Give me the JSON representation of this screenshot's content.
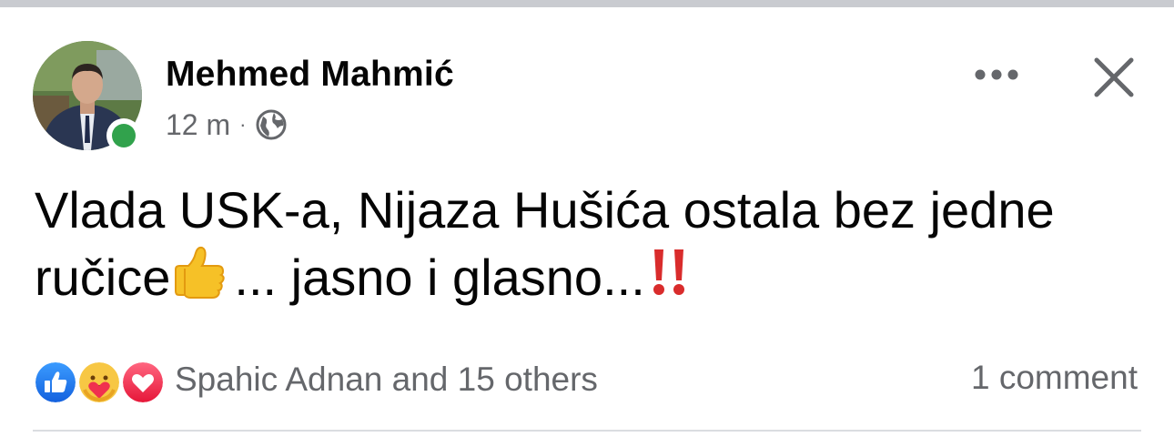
{
  "post": {
    "author": "Mehmed Mahmić",
    "time": "12 m",
    "separator": "·",
    "privacy_icon": "globe-icon",
    "online": true,
    "text_part1": "Vlada USK-a, Nijaza Hušića ostala bez jedne ručice",
    "emoji_inline": "thumbs-up-icon",
    "text_part2": "... jasno i glasno...",
    "emoji_end": "double-exclamation-icon"
  },
  "header_actions": {
    "more_icon": "more-horizontal-icon",
    "close_icon": "close-icon"
  },
  "reactions": {
    "icons": [
      "like-icon",
      "care-icon",
      "love-icon"
    ],
    "summary": "Spahic Adnan and 15 others"
  },
  "comments": {
    "label": "1 comment"
  },
  "colors": {
    "text_primary": "#050505",
    "text_secondary": "#65676b",
    "like_blue": "#1877f2",
    "love_red": "#f33e58",
    "online_green": "#31a24c",
    "divider": "#dadde1"
  }
}
